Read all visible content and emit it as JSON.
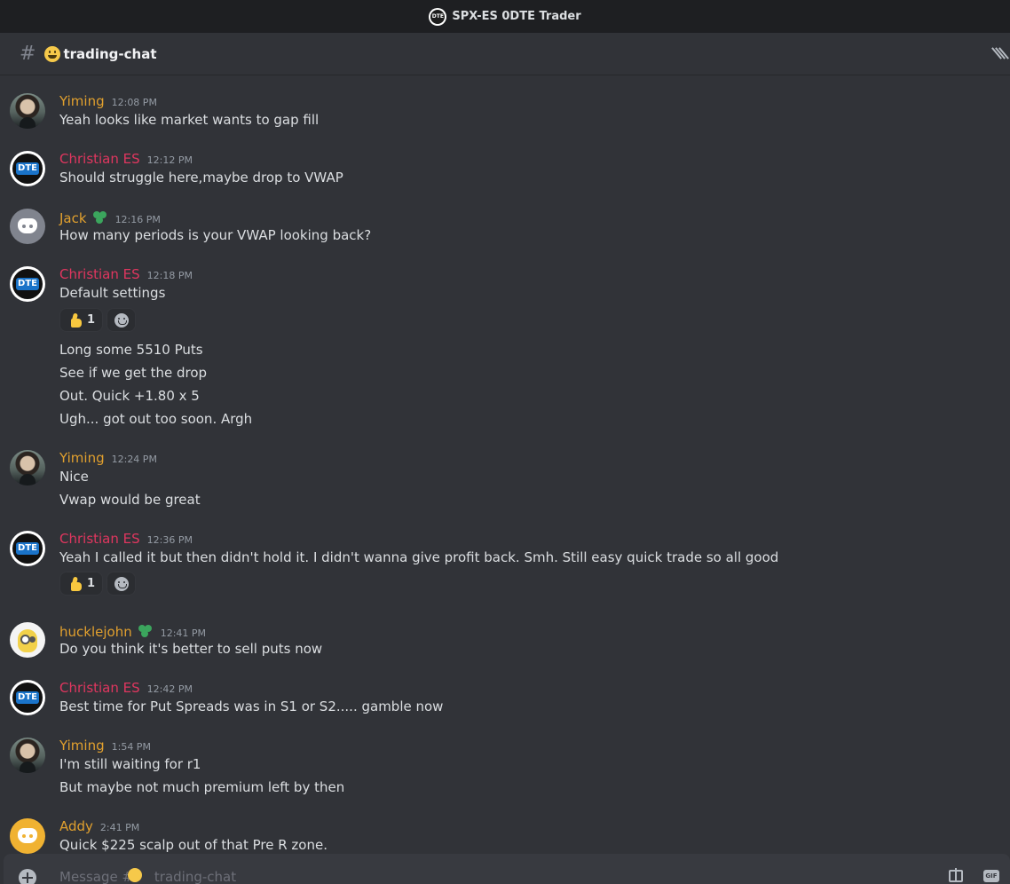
{
  "window": {
    "title": "SPX-ES 0DTE Trader"
  },
  "channel": {
    "name": "trading-chat"
  },
  "messages": [
    {
      "author": "Yiming",
      "time": "12:08 PM",
      "lines": [
        "Yeah looks like market wants to gap fill"
      ]
    },
    {
      "author": "Christian ES",
      "time": "12:12 PM",
      "lines": [
        "Should struggle here,maybe drop to VWAP"
      ]
    },
    {
      "author": "Jack",
      "time": "12:16 PM",
      "lines": [
        "How many periods is your VWAP looking back?"
      ]
    },
    {
      "author": "Christian ES",
      "time": "12:18 PM",
      "lines": [
        "Default settings",
        "Long some 5510 Puts",
        "See if we get the drop",
        "Out.  Quick +1.80 x 5",
        "Ugh... got out too soon. Argh"
      ],
      "reaction_count": "1"
    },
    {
      "author": "Yiming",
      "time": "12:24 PM",
      "lines": [
        "Nice",
        "Vwap would be great"
      ]
    },
    {
      "author": "Christian ES",
      "time": "12:36 PM",
      "lines": [
        "Yeah I called it but then didn't hold it. I didn't wanna give profit back. Smh. Still easy quick trade so all good"
      ],
      "reaction_count": "1"
    },
    {
      "author": "hucklejohn",
      "time": "12:41 PM",
      "lines": [
        "Do you think it's better to sell puts now"
      ]
    },
    {
      "author": "Christian ES",
      "time": "12:42 PM",
      "lines": [
        "Best time for Put Spreads was in S1 or S2..... gamble now"
      ]
    },
    {
      "author": "Yiming",
      "time": "1:54 PM",
      "lines": [
        "I'm still waiting for r1",
        "But maybe not much premium left by then"
      ]
    },
    {
      "author": "Addy",
      "time": "2:41 PM",
      "lines": [
        "Quick $225 scalp out of that Pre R zone."
      ]
    }
  ],
  "composer": {
    "placeholder": "Message #     trading-chat",
    "gif_label": "GIF"
  },
  "colors": {
    "yiming": "#e1a02e",
    "christian": "#e0365f",
    "background": "#313338"
  }
}
